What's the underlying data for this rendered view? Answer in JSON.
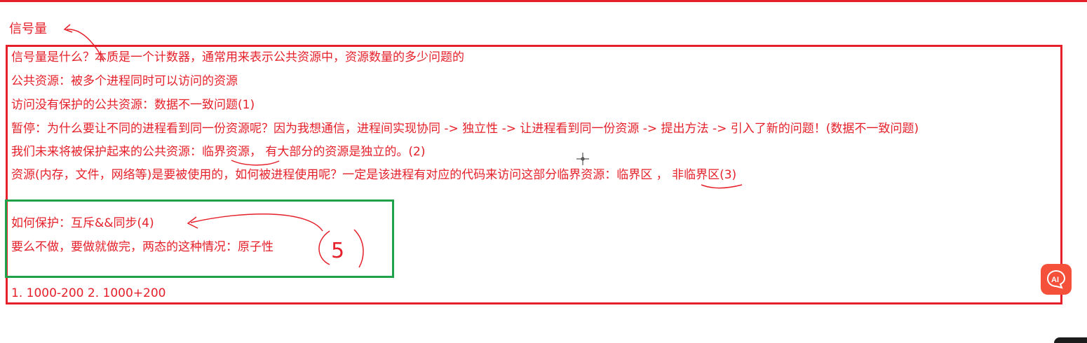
{
  "heading": "信号量",
  "lines": [
    "信号量是什么？本质是一个计数器，通常用来表示公共资源中，资源数量的多少问题的",
    "公共资源：被多个进程同时可以访问的资源",
    "访问没有保护的公共资源：数据不一致问题(1)",
    "暂停：为什么要让不同的进程看到同一份资源呢？因为我想通信，进程间实现协同 -> 独立性 -> 让进程看到同一份资源 -> 提出方法 -> 引入了新的问题！(数据不一致问题)",
    "我们未来将被保护起来的公共资源：临界资源， 有大部分的资源是独立的。(2)",
    "资源(内存，文件，网络等)是要被使用的，如何被进程使用呢？一定是该进程有对应的代码来访问这部分临界资源：临界区 ， 非临界区(3)",
    "如何保护：互斥&&同步(4)",
    "要么不做，要做就做完，两态的这种情况：原子性",
    "1. 1000-200 2. 1000+200"
  ],
  "annotation_label": "5",
  "ai_button": {
    "label": "AI",
    "color": "#f4503a"
  },
  "colors": {
    "text": "#e5202a",
    "red_box": "#e5202a",
    "green_box": "#1fa34a"
  }
}
